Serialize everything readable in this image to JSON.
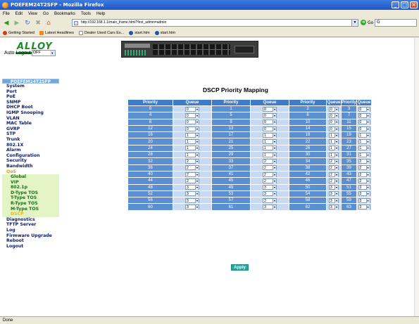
{
  "window": {
    "title": "POEFEM24T2SFP - Mozilla Firefox"
  },
  "menu": [
    "File",
    "Edit",
    "View",
    "Go",
    "Bookmarks",
    "Tools",
    "Help"
  ],
  "nav": {
    "url": "http://192.168.1.1/main_frame.html?first_admin=admin",
    "go_label": "Go"
  },
  "bookmarks": [
    "Getting Started",
    "Latest Headlines",
    "Dealer Used Cars Es...",
    "start.htm",
    "start.htm"
  ],
  "brand": {
    "logo": "ALLOY"
  },
  "auto_logout": {
    "label": "Auto Logout",
    "value": "OFF"
  },
  "sidebar": {
    "header": "POEFEM24T2SFP",
    "items": [
      "System",
      "Port",
      "PoE",
      "SNMP",
      "DHCP Boot",
      "IGMP Snooping",
      "VLAN",
      "MAC Table",
      "GVRP",
      "STP",
      "Trunk",
      "802.1X",
      "Alarm",
      "Configuration",
      "Security",
      "Bandwidth",
      "QoS"
    ],
    "qos_sub": [
      "Global",
      "VIP",
      "802.1p",
      "D-Type TOS",
      "T-Type TOS",
      "R-Type TOS",
      "M-Type TOS",
      "DSCP"
    ],
    "items_after": [
      "Diagnostics",
      "TFTP Server",
      "Log",
      "Firmware Upgrade",
      "Reboot",
      "Logout"
    ]
  },
  "main": {
    "title": "DSCP Priority Mapping",
    "col_priority": "Priority",
    "col_queue": "Queue",
    "apply_label": "Apply",
    "rows": [
      [
        [
          0,
          "0"
        ],
        [
          1,
          "0"
        ],
        [
          2,
          "0"
        ],
        [
          3,
          "0"
        ]
      ],
      [
        [
          4,
          "0"
        ],
        [
          5,
          "0"
        ],
        [
          6,
          "0"
        ],
        [
          7,
          "0"
        ]
      ],
      [
        [
          8,
          "0"
        ],
        [
          9,
          "0"
        ],
        [
          10,
          "0"
        ],
        [
          11,
          "0"
        ]
      ],
      [
        [
          12,
          "0"
        ],
        [
          13,
          "0"
        ],
        [
          14,
          "0"
        ],
        [
          15,
          "0"
        ]
      ],
      [
        [
          16,
          "1"
        ],
        [
          17,
          "1"
        ],
        [
          18,
          "1"
        ],
        [
          19,
          "1"
        ]
      ],
      [
        [
          20,
          "1"
        ],
        [
          21,
          "1"
        ],
        [
          22,
          "1"
        ],
        [
          23,
          "1"
        ]
      ],
      [
        [
          24,
          "1"
        ],
        [
          25,
          "1"
        ],
        [
          26,
          "1"
        ],
        [
          27,
          "1"
        ]
      ],
      [
        [
          28,
          "1"
        ],
        [
          29,
          "1"
        ],
        [
          30,
          "1"
        ],
        [
          31,
          "1"
        ]
      ],
      [
        [
          32,
          "2"
        ],
        [
          33,
          "2"
        ],
        [
          34,
          "2"
        ],
        [
          35,
          "2"
        ]
      ],
      [
        [
          36,
          "2"
        ],
        [
          37,
          "2"
        ],
        [
          38,
          "2"
        ],
        [
          39,
          "2"
        ]
      ],
      [
        [
          40,
          "2"
        ],
        [
          41,
          "2"
        ],
        [
          42,
          "2"
        ],
        [
          43,
          "2"
        ]
      ],
      [
        [
          44,
          "2"
        ],
        [
          45,
          "2"
        ],
        [
          46,
          "2"
        ],
        [
          47,
          "2"
        ]
      ],
      [
        [
          48,
          "3"
        ],
        [
          49,
          "3"
        ],
        [
          50,
          "3"
        ],
        [
          51,
          "3"
        ]
      ],
      [
        [
          52,
          "3"
        ],
        [
          53,
          "3"
        ],
        [
          54,
          "3"
        ],
        [
          55,
          "3"
        ]
      ],
      [
        [
          56,
          "3"
        ],
        [
          57,
          "3"
        ],
        [
          58,
          "3"
        ],
        [
          59,
          "3"
        ]
      ],
      [
        [
          60,
          "3"
        ],
        [
          61,
          "3"
        ],
        [
          62,
          "3"
        ],
        [
          63,
          "3"
        ]
      ]
    ]
  },
  "statusbar": {
    "text": "Done"
  }
}
